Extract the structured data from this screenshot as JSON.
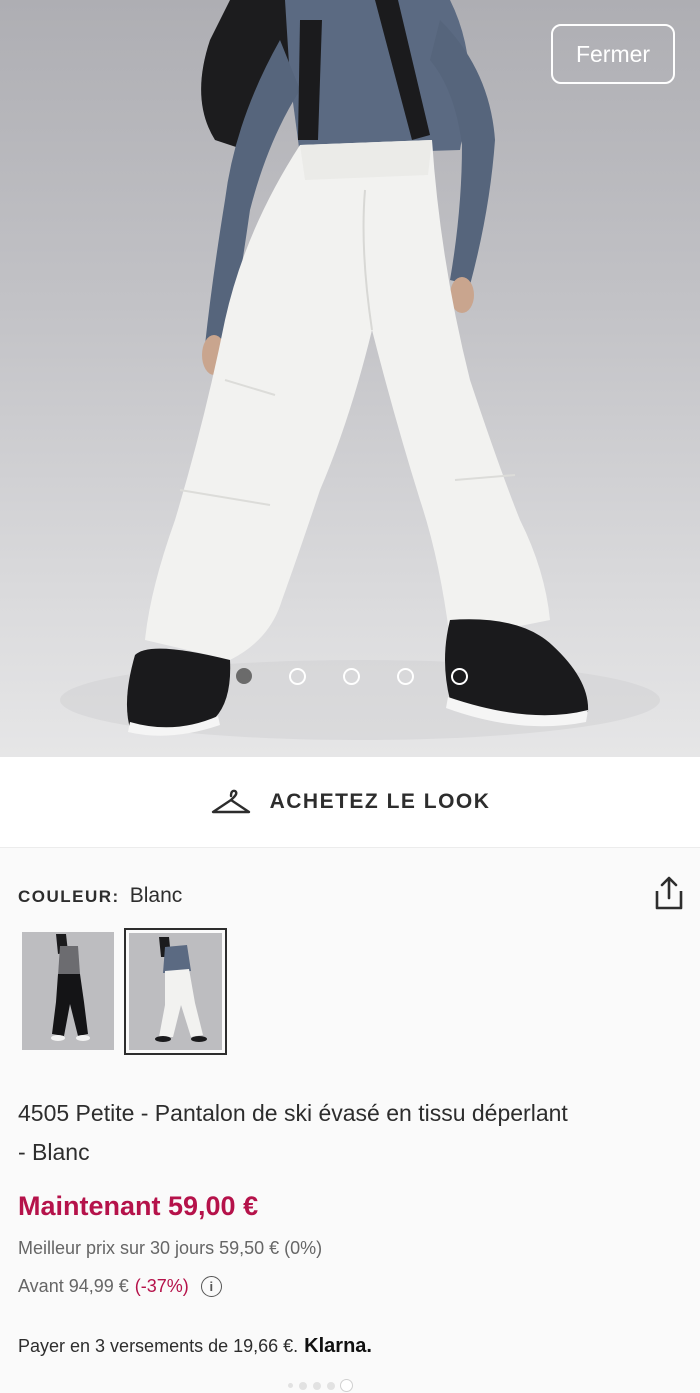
{
  "hero": {
    "close_label": "Fermer",
    "carousel": {
      "count": 5,
      "active_index": 0
    }
  },
  "look": {
    "label": "ACHETEZ LE LOOK",
    "icon": "hanger-icon"
  },
  "product": {
    "colour_key": "COULEUR:",
    "colour_value": "Blanc",
    "title": "4505 Petite - Pantalon de ski évasé en tissu déperlant - Blanc",
    "price_now": "Maintenant 59,00 €",
    "best_price": "Meilleur prix sur 30 jours 59,50 € (0%)",
    "before_price": "Avant 94,99 €",
    "discount": "(-37%)",
    "info_icon": "i",
    "klarna_text": "Payer en 3 versements de 19,66 €.",
    "klarna_brand": "Klarna."
  },
  "colors": {
    "price": "#b5124a",
    "text": "#2d2d2d",
    "muted": "#666666"
  }
}
